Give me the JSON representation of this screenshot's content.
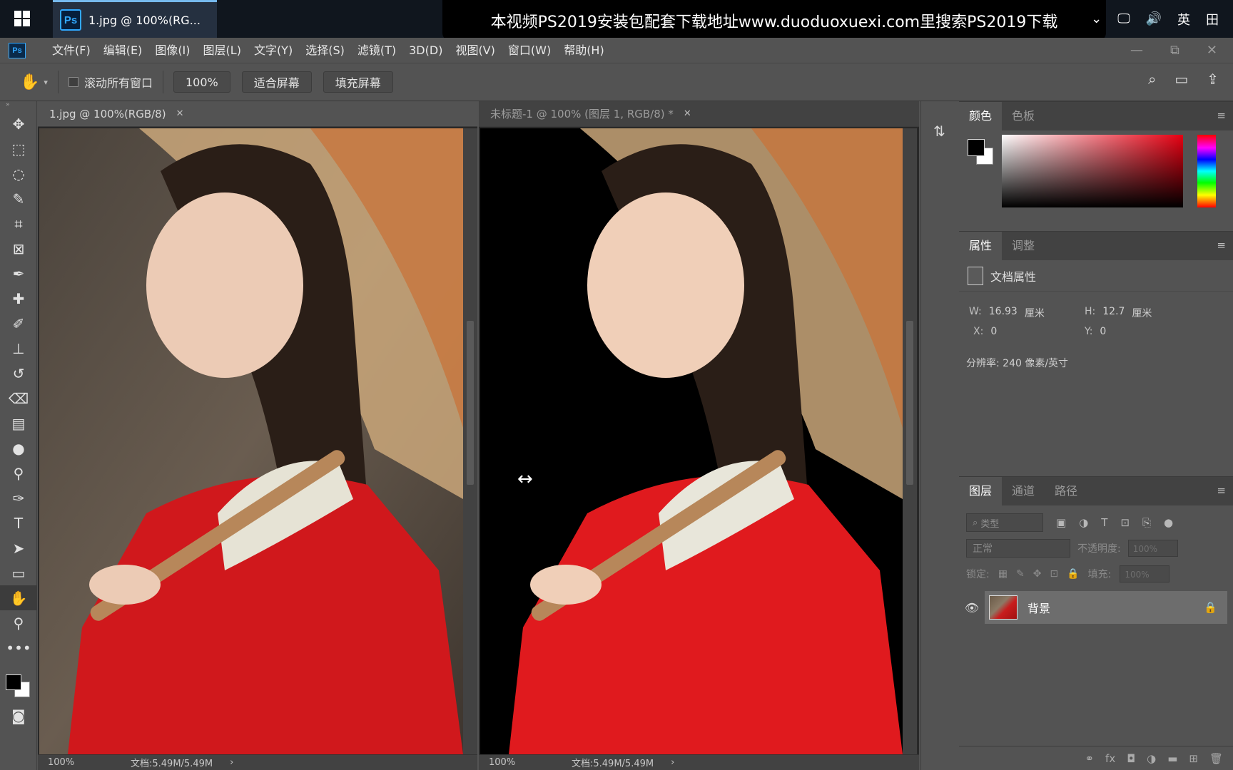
{
  "taskbar": {
    "app_label": "1.jpg @ 100%(RG...",
    "ps_badge": "Ps",
    "banner_text": "本视频PS2019安装包配套下载地址www.duoduoxuexi.com里搜索PS2019下载",
    "tray_icons": [
      "chevron-up-icon",
      "network-icon",
      "volume-icon"
    ],
    "ime_label": "英",
    "ime_grid": "田"
  },
  "menubar": {
    "ps_label": "Ps",
    "items": [
      "文件(F)",
      "编辑(E)",
      "图像(I)",
      "图层(L)",
      "文字(Y)",
      "选择(S)",
      "滤镜(T)",
      "3D(D)",
      "视图(V)",
      "窗口(W)",
      "帮助(H)"
    ]
  },
  "options": {
    "scroll_all_label": "滚动所有窗口",
    "zoom_btn": "100%",
    "fit_btn": "适合屏幕",
    "fill_btn": "填充屏幕"
  },
  "tools": [
    "move-tool",
    "marquee-tool",
    "lasso-tool",
    "quick-select-tool",
    "crop-tool",
    "frame-tool",
    "eyedropper-tool",
    "healing-tool",
    "brush-tool",
    "stamp-tool",
    "history-brush-tool",
    "eraser-tool",
    "gradient-tool",
    "blur-tool",
    "dodge-tool",
    "pen-tool",
    "type-tool",
    "path-select-tool",
    "rectangle-tool",
    "hand-tool",
    "zoom-tool",
    "more-tool"
  ],
  "doc1": {
    "tab_title": "1.jpg @ 100%(RGB/8)",
    "zoom": "100%",
    "doc_size": "文档:5.49M/5.49M"
  },
  "doc2": {
    "tab_title": "未标题-1 @ 100% (图层 1, RGB/8) *",
    "zoom": "100%",
    "doc_size": "文档:5.49M/5.49M"
  },
  "panels": {
    "color": {
      "tabs": [
        "颜色",
        "色板"
      ]
    },
    "properties": {
      "tabs": [
        "属性",
        "调整"
      ],
      "heading": "文档属性",
      "w_label": "W:",
      "w_value": "16.93",
      "w_unit": "厘米",
      "h_label": "H:",
      "h_value": "12.7",
      "h_unit": "厘米",
      "x_label": "X:",
      "x_value": "0",
      "y_label": "Y:",
      "y_value": "0",
      "resolution": "分辨率: 240 像素/英寸"
    },
    "layers": {
      "tabs": [
        "图层",
        "通道",
        "路径"
      ],
      "filter_placeholder": "类型",
      "blend_mode": "正常",
      "opacity_label": "不透明度:",
      "opacity_value": "100%",
      "lock_label": "锁定:",
      "fill_label": "填充:",
      "fill_value": "100%",
      "layer_name": "背景"
    }
  },
  "colors": {
    "accent": "#31a8ff",
    "foreground": "#000000",
    "background": "#ffffff"
  }
}
